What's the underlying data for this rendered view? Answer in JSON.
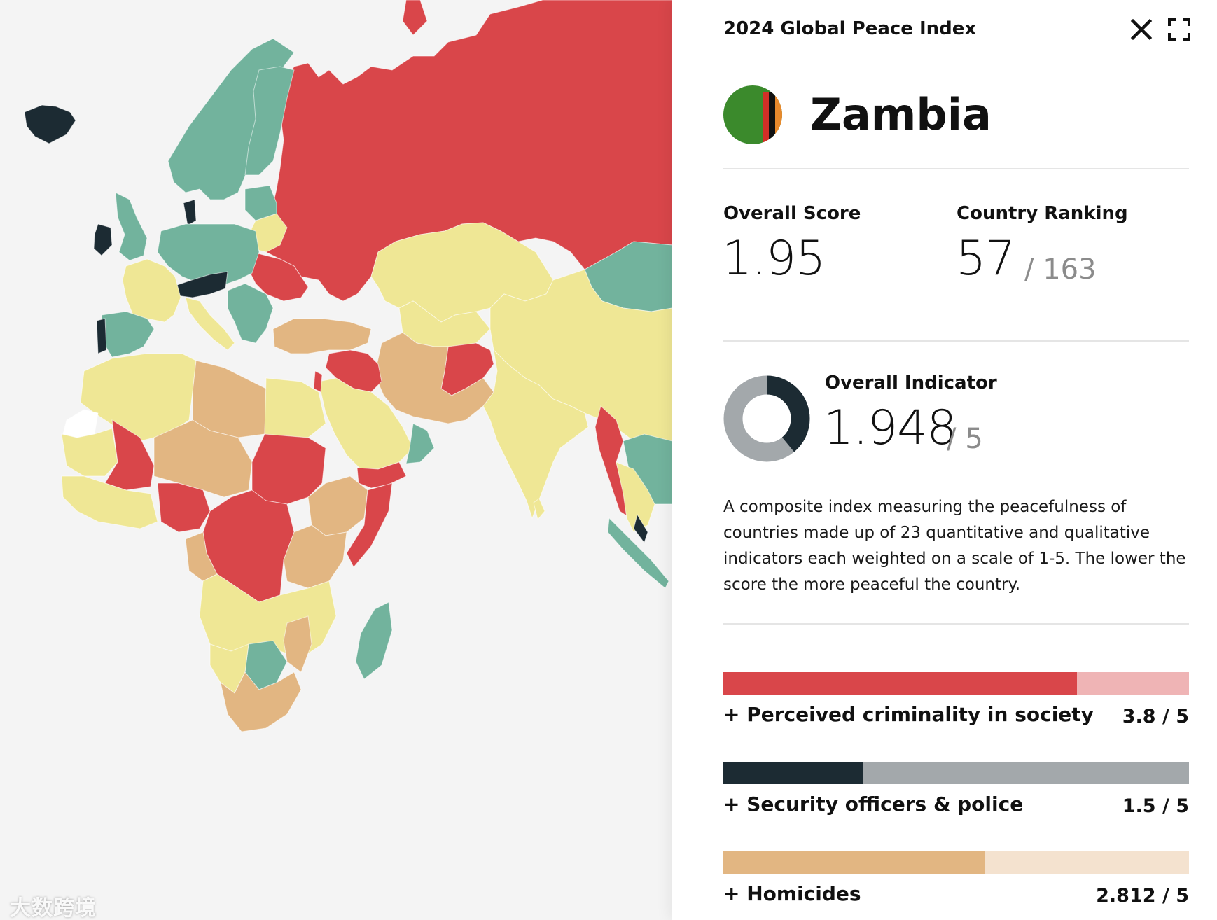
{
  "map": {
    "colors": {
      "very_high_peace": "#1c2b33",
      "high_peace": "#72b39d",
      "medium_peace": "#efe795",
      "low_peace": "#e2b682",
      "very_low_peace": "#d9464a",
      "no_data": "#ffffff",
      "ocean": "#f4f4f4"
    }
  },
  "watermark": {
    "text": "大数跨境"
  },
  "panel": {
    "title": "2024 Global Peace Index",
    "close_icon": "close-icon",
    "expand_icon": "expand-icon",
    "country": {
      "name": "Zambia",
      "flag_icon": "zambia-flag-icon",
      "flag_colors": [
        "#3b8a2c",
        "#d22f27",
        "#111111",
        "#e8892c"
      ]
    },
    "overall_score": {
      "label": "Overall Score",
      "value": "1.95"
    },
    "country_ranking": {
      "label": "Country Ranking",
      "value": "57",
      "total": "/ 163"
    },
    "overall_indicator": {
      "label": "Overall Indicator",
      "value": "1.948",
      "max": "/ 5",
      "fraction": 0.3896,
      "fill_color": "#1c2b33",
      "track_color": "#a3a8ab"
    },
    "description": "A composite index measuring the peacefulness of countries made up of 23 quantitative and qualitative indicators each weighted on a scale of 1-5. The lower the score the more peaceful the country.",
    "indicators": [
      {
        "label": "+ Perceived criminality in society",
        "value": "3.8 / 5",
        "score": 3.8,
        "max": 5,
        "fill_color": "#d9464a",
        "track_color": "#efb4b5"
      },
      {
        "label": "+ Security officers & police",
        "value": "1.5 / 5",
        "score": 1.5,
        "max": 5,
        "fill_color": "#1c2b33",
        "track_color": "#a3a8ab"
      },
      {
        "label": "+ Homicides",
        "value": "2.812 / 5",
        "score": 2.812,
        "max": 5,
        "fill_color": "#e2b682",
        "track_color": "#f4e2cf"
      }
    ]
  }
}
